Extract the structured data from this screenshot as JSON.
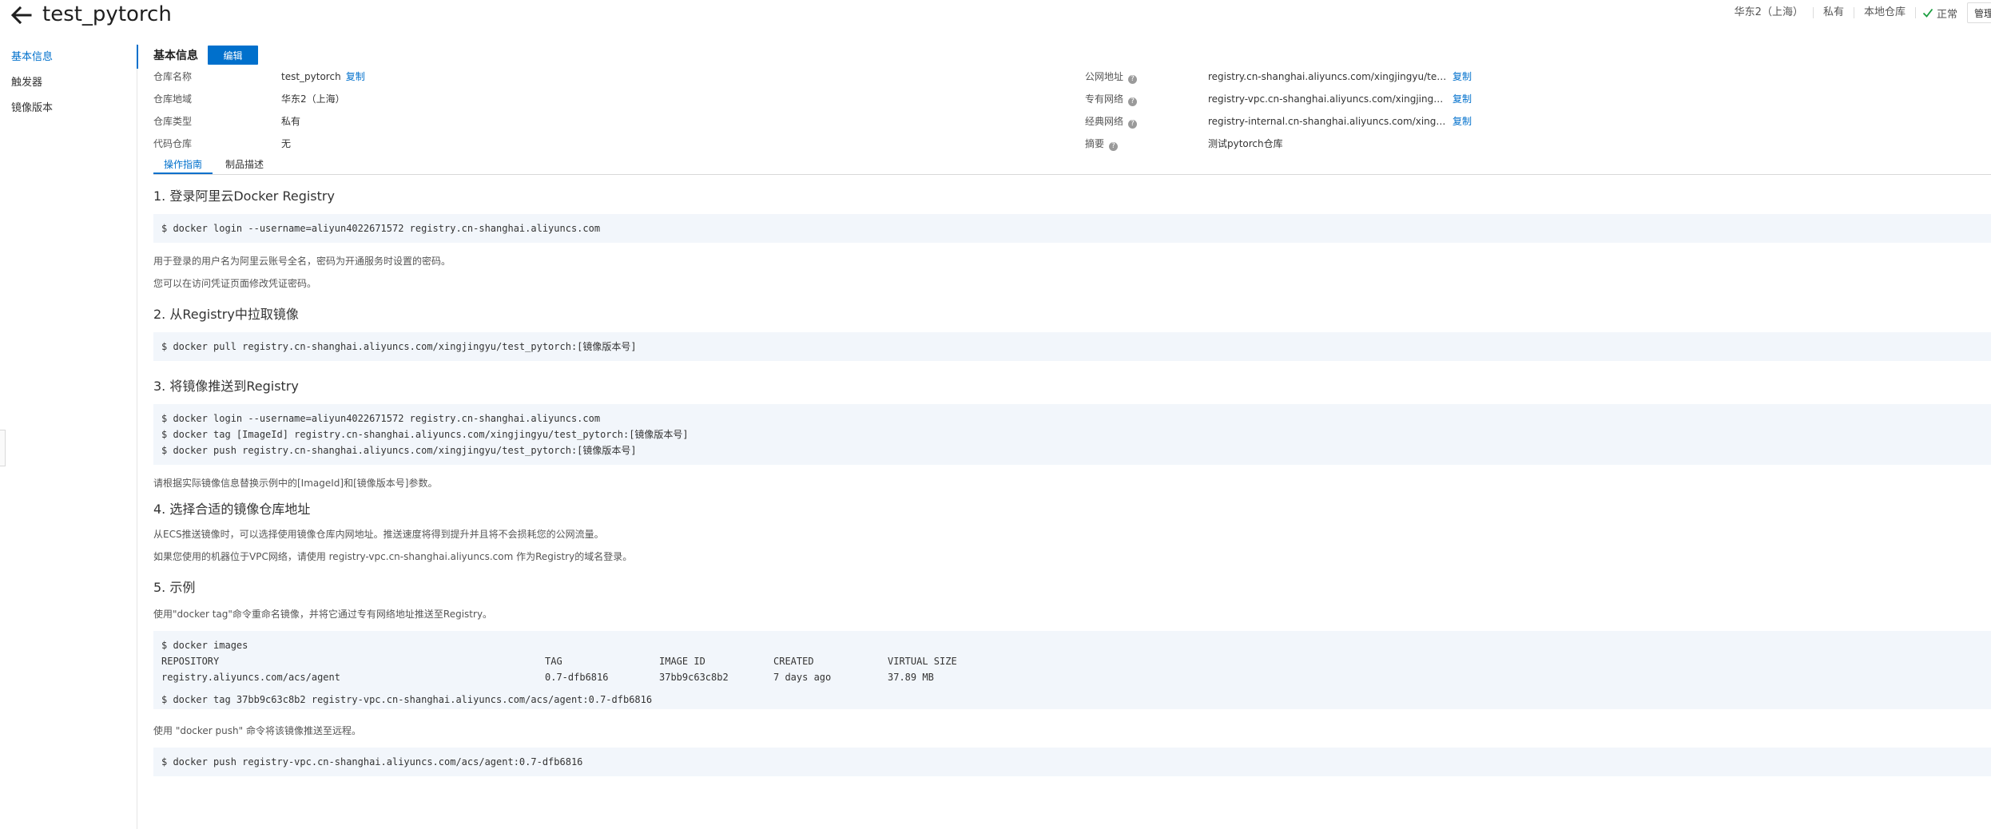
{
  "header": {
    "title": "test_pytorch",
    "meta": [
      "华东2（上海）",
      "私有",
      "本地仓库"
    ],
    "status": "正常",
    "action_label": "管理"
  },
  "sidebar": {
    "items": [
      {
        "label": "基本信息"
      },
      {
        "label": "触发器"
      },
      {
        "label": "镜像版本"
      }
    ]
  },
  "basic": {
    "title": "基本信息",
    "edit_label": "编辑",
    "left": [
      {
        "label": "仓库名称",
        "value": "test_pytorch",
        "copy": "复制"
      },
      {
        "label": "仓库地域",
        "value": "华东2（上海）"
      },
      {
        "label": "仓库类型",
        "value": "私有"
      },
      {
        "label": "代码仓库",
        "value": "无"
      }
    ],
    "right": [
      {
        "label": "公网地址",
        "value": "registry.cn-shanghai.aliyuncs.com/xingjingyu/test_pyto...",
        "copy": "复制"
      },
      {
        "label": "专有网络",
        "value": "registry-vpc.cn-shanghai.aliyuncs.com/xingjingyu/test_...",
        "copy": "复制"
      },
      {
        "label": "经典网络",
        "value": "registry-internal.cn-shanghai.aliyuncs.com/xingjingyu/t...",
        "copy": "复制"
      },
      {
        "label": "摘要",
        "value": "测试pytorch仓库"
      }
    ]
  },
  "tabs": [
    {
      "label": "操作指南"
    },
    {
      "label": "制品描述"
    }
  ],
  "guide": {
    "s1_title": "1. 登录阿里云Docker Registry",
    "s1_code": "$ docker login --username=aliyun4022671572 registry.cn-shanghai.aliyuncs.com",
    "s1_p1": "用于登录的用户名为阿里云账号全名，密码为开通服务时设置的密码。",
    "s1_p2": "您可以在访问凭证页面修改凭证密码。",
    "s2_title": "2. 从Registry中拉取镜像",
    "s2_code": "$ docker pull registry.cn-shanghai.aliyuncs.com/xingjingyu/test_pytorch:[镜像版本号]",
    "s3_title": "3. 将镜像推送到Registry",
    "s3_code1": "$ docker login --username=aliyun4022671572 registry.cn-shanghai.aliyuncs.com",
    "s3_code2": "$ docker tag [ImageId] registry.cn-shanghai.aliyuncs.com/xingjingyu/test_pytorch:[镜像版本号]",
    "s3_code3": "$ docker push registry.cn-shanghai.aliyuncs.com/xingjingyu/test_pytorch:[镜像版本号]",
    "s3_p": "请根据实际镜像信息替换示例中的[ImageId]和[镜像版本号]参数。",
    "s4_title": "4. 选择合适的镜像仓库地址",
    "s4_p1": "从ECS推送镜像时，可以选择使用镜像仓库内网地址。推送速度将得到提升并且将不会损耗您的公网流量。",
    "s4_p2": "如果您使用的机器位于VPC网络，请使用 registry-vpc.cn-shanghai.aliyuncs.com 作为Registry的域名登录。",
    "s5_title": "5. 示例",
    "s5_p1": "使用\"docker tag\"命令重命名镜像，并将它通过专有网络地址推送至Registry。",
    "s5_cmd": "$ docker images",
    "s5_headers": [
      "REPOSITORY",
      "TAG",
      "IMAGE ID",
      "CREATED",
      "VIRTUAL SIZE"
    ],
    "s5_row": [
      "registry.aliyuncs.com/acs/agent",
      "0.7-dfb6816",
      "37bb9c63c8b2",
      "7 days ago",
      "37.89 MB"
    ],
    "s5_tag_cmd": "$ docker tag 37bb9c63c8b2 registry-vpc.cn-shanghai.aliyuncs.com/acs/agent:0.7-dfb6816",
    "s5_p2": "使用 \"docker push\" 命令将该镜像推送至远程。",
    "s5_push_cmd": "$ docker push registry-vpc.cn-shanghai.aliyuncs.com/acs/agent:0.7-dfb6816"
  }
}
